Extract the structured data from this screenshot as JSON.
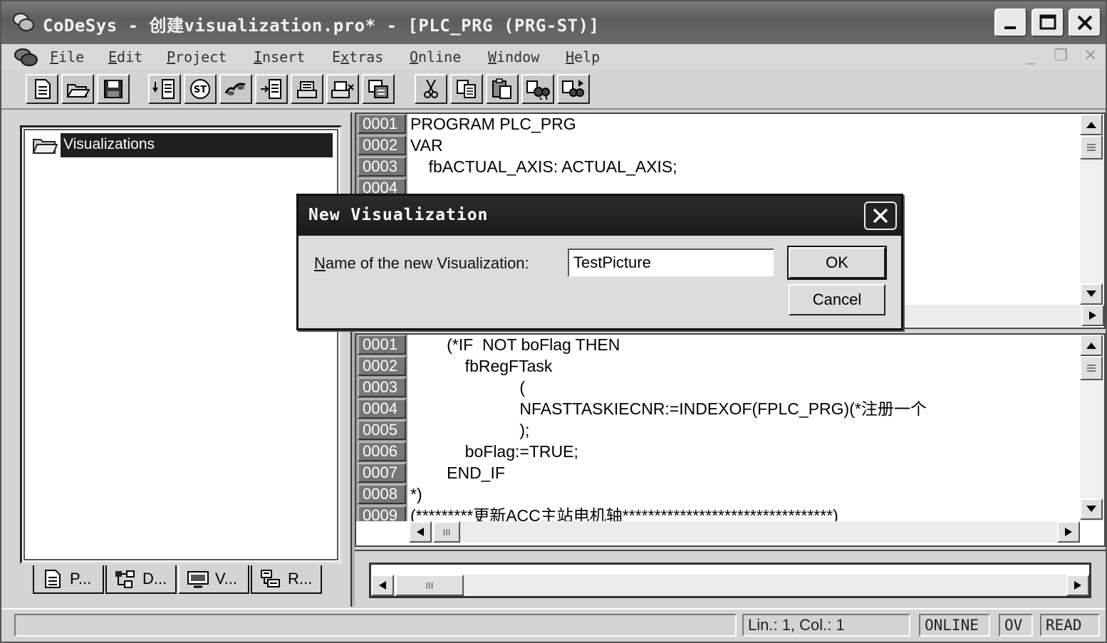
{
  "window": {
    "title": "CoDeSys - 创建visualization.pro* - [PLC_PRG (PRG-ST)]",
    "app_icon": "codesys-icon"
  },
  "menubar": {
    "items": [
      {
        "pre": "",
        "key": "F",
        "rest": "ile"
      },
      {
        "pre": "",
        "key": "E",
        "rest": "dit"
      },
      {
        "pre": "",
        "key": "P",
        "rest": "roject"
      },
      {
        "pre": "",
        "key": "I",
        "rest": "nsert"
      },
      {
        "pre": "E",
        "key": "x",
        "rest": "tras"
      },
      {
        "pre": "",
        "key": "O",
        "rest": "nline"
      },
      {
        "pre": "",
        "key": "W",
        "rest": "indow"
      },
      {
        "pre": "",
        "key": "H",
        "rest": "elp"
      }
    ]
  },
  "toolbar": {
    "icons": [
      "new-file-icon",
      "open-folder-icon",
      "save-icon",
      "insert-declaration-icon",
      "st-language-icon",
      "step-icon",
      "insert-pou-icon",
      "login-icon",
      "logout-icon",
      "build-icon",
      "cut-icon",
      "copy-icon",
      "paste-icon",
      "find-icon",
      "find-next-icon"
    ]
  },
  "tree": {
    "selected_item": "Visualizations"
  },
  "tabs": [
    {
      "label": "P...",
      "icon": "pou-tab-icon"
    },
    {
      "label": "D...",
      "icon": "datatypes-tab-icon"
    },
    {
      "label": "V...",
      "icon": "visualizations-tab-icon"
    },
    {
      "label": "R...",
      "icon": "resources-tab-icon"
    }
  ],
  "declaration": {
    "lines": [
      {
        "num": "0001",
        "text": "PROGRAM PLC_PRG"
      },
      {
        "num": "0002",
        "text": "VAR"
      },
      {
        "num": "0003",
        "text": "    fbACTUAL_AXIS: ACTUAL_AXIS;"
      },
      {
        "num": "0004",
        "text": ""
      }
    ]
  },
  "implementation": {
    "lines": [
      {
        "num": "0001",
        "text": "        (*IF  NOT boFlag THEN"
      },
      {
        "num": "0002",
        "text": "            fbRegFTask"
      },
      {
        "num": "0003",
        "text": "                        ("
      },
      {
        "num": "0004",
        "text": "                        NFASTTASKIECNR:=INDEXOF(FPLC_PRG)(*注册一个"
      },
      {
        "num": "0005",
        "text": "                        );"
      },
      {
        "num": "0006",
        "text": "            boFlag:=TRUE;"
      },
      {
        "num": "0007",
        "text": "        END_IF"
      },
      {
        "num": "0008",
        "text": "*)"
      },
      {
        "num": "0009",
        "text": "(*********更新ACC主站电机轴*********************************)"
      }
    ]
  },
  "statusbar": {
    "position": "Lin.: 1, Col.: 1",
    "online": "ONLINE",
    "ov": "OV",
    "read": "READ"
  },
  "dialog": {
    "title": "New Visualization",
    "label_key": "N",
    "label_rest": "ame of the new Visualization:",
    "input_value": "TestPicture",
    "ok_label": "OK",
    "cancel_label": "Cancel"
  },
  "scrollbar": {
    "thumb_glyph": "III"
  }
}
